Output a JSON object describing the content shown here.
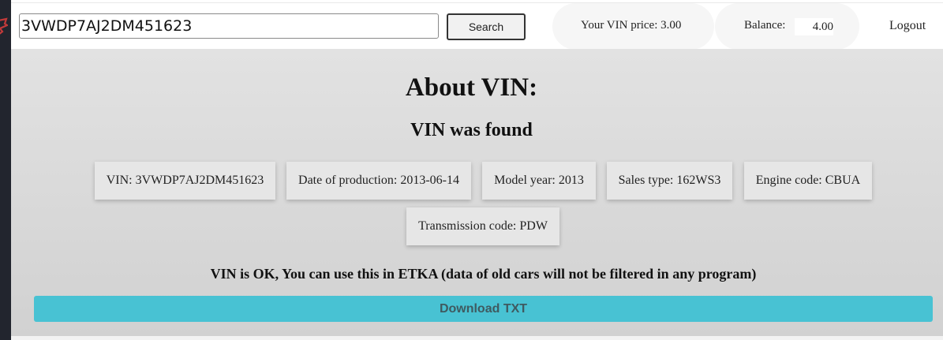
{
  "search": {
    "value": "3VWDP7AJ2DM451623",
    "button_label": "Search"
  },
  "header": {
    "price_text": "Your VIN price: 3.00",
    "balance_label": "Balance:",
    "balance_value": "4.00",
    "logout_label": "Logout"
  },
  "main": {
    "title": "About VIN:",
    "subtitle": "VIN was found",
    "info_cards": [
      {
        "text": "VIN: 3VWDP7AJ2DM451623"
      },
      {
        "text": "Date of production: 2013-06-14"
      },
      {
        "text": "Model year: 2013"
      },
      {
        "text": "Sales type: 162WS3"
      },
      {
        "text": "Engine code: CBUA"
      },
      {
        "text": "Transmission code: PDW"
      }
    ],
    "status_message": "VIN is OK, You can use this in ETKA (data of old cars will not be filtered in any program)",
    "download_label": "Download TXT"
  },
  "colors": {
    "download_button": "#48c2d3",
    "sidebar_strip": "#22252e"
  },
  "icons": {
    "logo": "brand-logo-icon"
  }
}
